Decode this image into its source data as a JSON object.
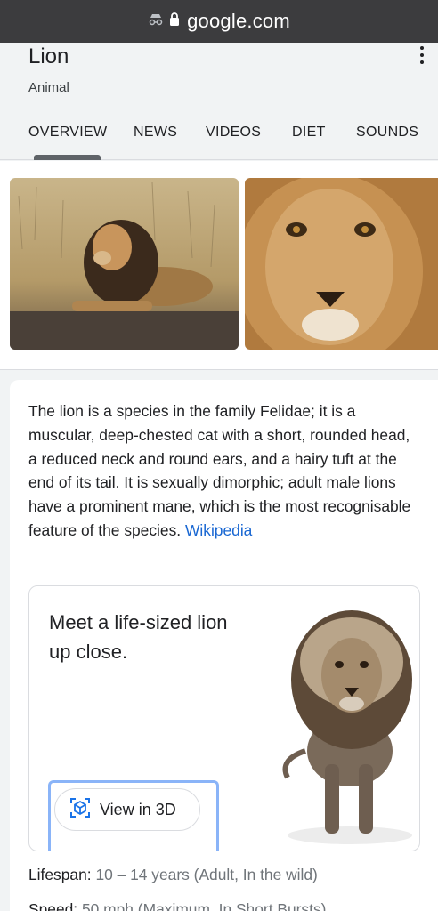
{
  "browser": {
    "url": "google.com"
  },
  "entity": {
    "title": "Lion",
    "subtitle": "Animal"
  },
  "tabs": [
    {
      "label": "OVERVIEW",
      "active": true
    },
    {
      "label": "NEWS"
    },
    {
      "label": "VIDEOS"
    },
    {
      "label": "DIET"
    },
    {
      "label": "SOUNDS"
    }
  ],
  "description": {
    "text": "The lion is a species in the family Felidae; it is a muscular, deep-chested cat with a short, rounded head, a reduced neck and round ears, and a hairy tuft at the end of its tail. It is sexually dimorphic; adult male lions have a prominent mane, which is the most recognisable feature of the species.",
    "source": "Wikipedia"
  },
  "ar_card": {
    "headline": "Meet a life-sized lion up close.",
    "button_label": "View in 3D"
  },
  "facts": [
    {
      "label": "Lifespan:",
      "value": "10 – 14 years (Adult, In the wild)"
    },
    {
      "label": "Speed:",
      "value": "50 mph (Maximum, In Short Bursts)"
    }
  ],
  "colors": {
    "link": "#1967d2",
    "accent_outline": "#8ab4f8",
    "topbar": "#3c3c3e"
  }
}
